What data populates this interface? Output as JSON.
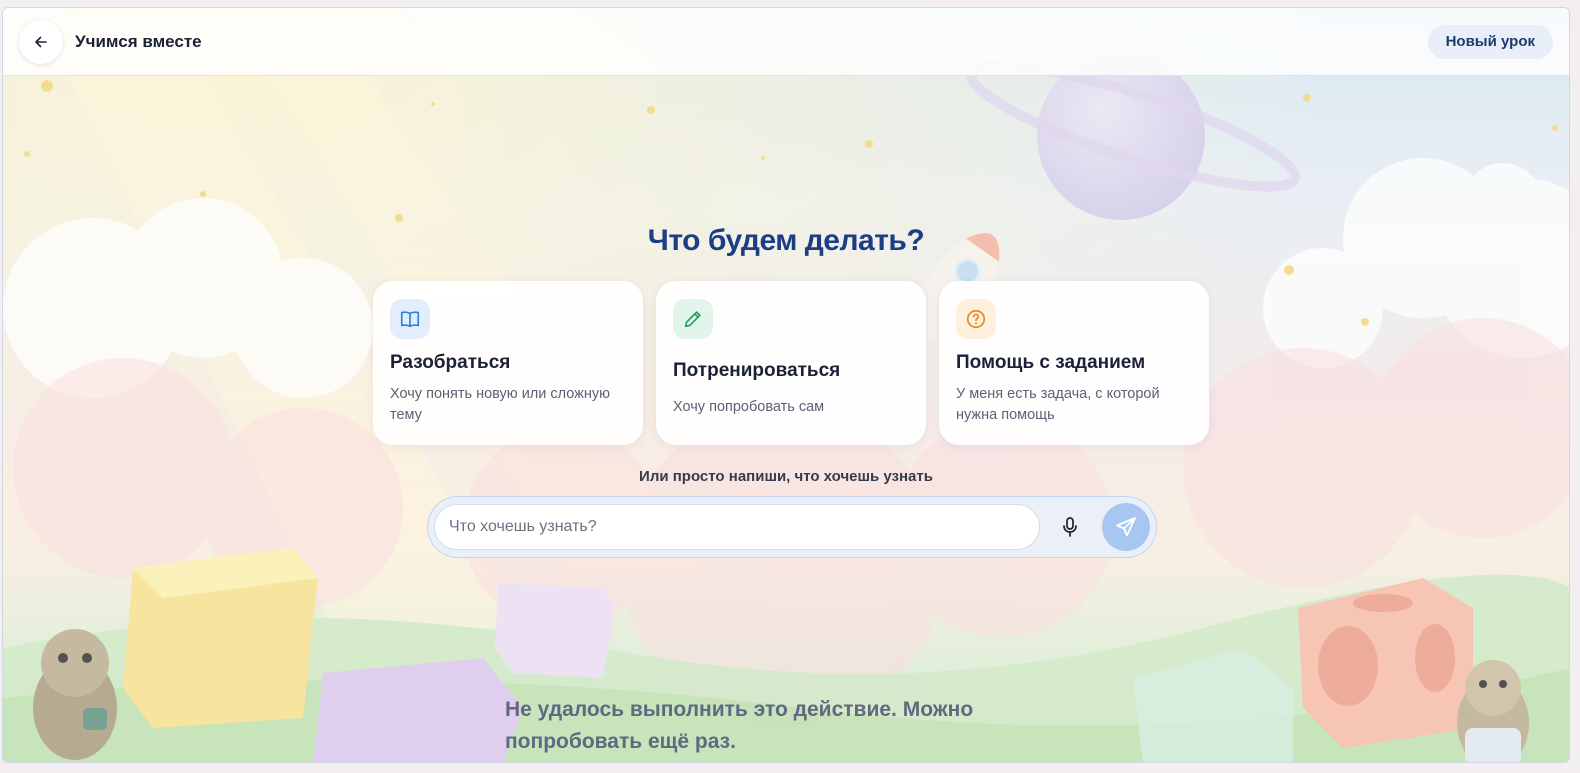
{
  "header": {
    "title": "Учимся вместе",
    "new_lesson_label": "Новый урок"
  },
  "main": {
    "heading": "Что будем делать?",
    "cards": [
      {
        "title": "Разобраться",
        "description": "Хочу понять новую или сложную тему",
        "icon": "book-icon",
        "accent": "#2f7de1",
        "icon_bg": "#e3eefc"
      },
      {
        "title": "Потренироваться",
        "description": "Хочу попробовать сам",
        "icon": "pencil-icon",
        "accent": "#21a05a",
        "icon_bg": "#e2f5ea"
      },
      {
        "title": "Помощь с заданием",
        "description": "У меня есть задача, с которой нужна помощь",
        "icon": "question-circle-icon",
        "accent": "#e08a1e",
        "icon_bg": "#fdf0dc"
      }
    ],
    "hint": "Или просто напиши, что хочешь узнать",
    "input": {
      "value": "",
      "placeholder": "Что хочешь узнать?"
    },
    "mic_icon": "microphone-icon",
    "send_icon": "send-icon"
  },
  "error_message": "Не удалось выполнить это действие. Можно попробовать ещё раз.",
  "colors": {
    "heading": "#1d3e86",
    "send_button": "#a8c6f2",
    "new_lesson_bg": "#e8eff9"
  }
}
